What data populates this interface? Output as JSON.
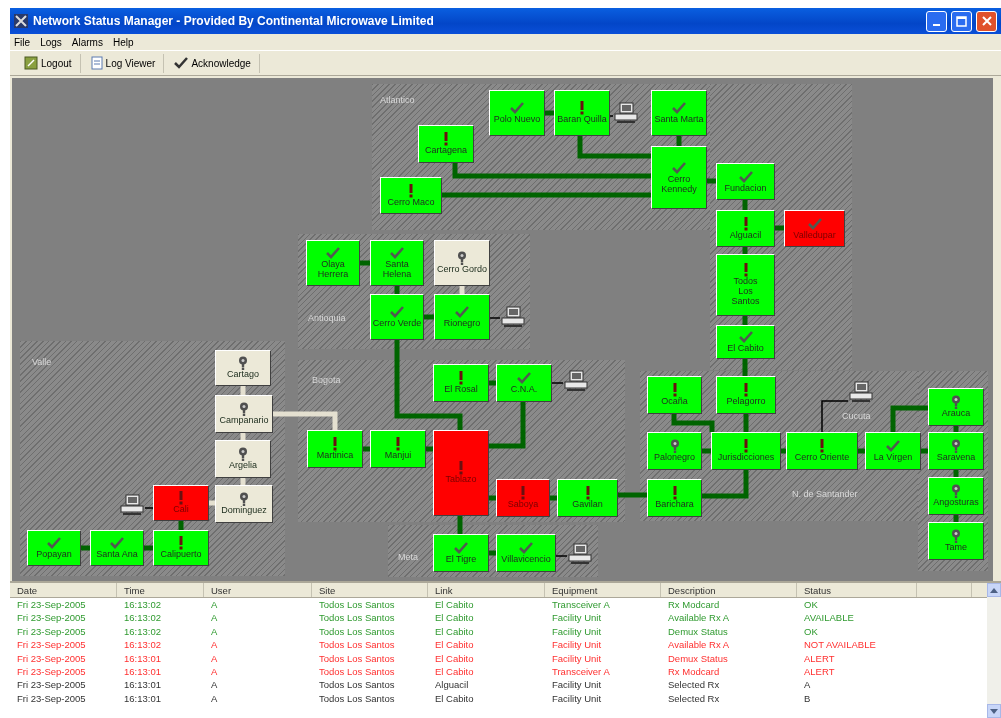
{
  "window": {
    "title": "Network Status Manager - Provided By Continental Microwave Limited"
  },
  "menu": [
    "File",
    "Logs",
    "Alarms",
    "Help"
  ],
  "toolbar": [
    {
      "label": "Logout",
      "kind": "logout"
    },
    {
      "label": "Log Viewer",
      "kind": "viewer"
    },
    {
      "label": "Acknowledge",
      "kind": "ack"
    }
  ],
  "regions": [
    {
      "name": "Atlantico"
    },
    {
      "name": "Antioquia"
    },
    {
      "name": "Valle"
    },
    {
      "name": "Bogota"
    },
    {
      "name": "Meta"
    },
    {
      "name": "N. de Santander"
    }
  ],
  "terminal_labels": [
    "Cucuta"
  ],
  "nodes": [
    {
      "label": "Polo Nuevo",
      "kind": "ok",
      "color": "#00ff00"
    },
    {
      "label": "Baran Quilla",
      "kind": "alert",
      "color": "#00ff00"
    },
    {
      "label": "Santa Marta",
      "kind": "ok",
      "color": "#00ff00"
    },
    {
      "label": "Cartagena",
      "kind": "alert",
      "color": "#00ff00"
    },
    {
      "label": "Cerro Kennedy",
      "kind": "ok",
      "color": "#00ff00"
    },
    {
      "label": "Cerro Maco",
      "kind": "alert",
      "color": "#00ff00"
    },
    {
      "label": "Fundacion",
      "kind": "ok",
      "color": "#00ff00"
    },
    {
      "label": "Alguacil",
      "kind": "alert",
      "color": "#00ff00"
    },
    {
      "label": "Valledupar",
      "kind": "ok",
      "color": "#ff0000"
    },
    {
      "label": "Todos Los Santos",
      "kind": "alert",
      "color": "#00ff00"
    },
    {
      "label": "El Cabito",
      "kind": "ok",
      "color": "#00ff00"
    },
    {
      "label": "Olaya Herrera",
      "kind": "ok",
      "color": "#00ff00"
    },
    {
      "label": "Santa Helena",
      "kind": "ok",
      "color": "#00ff00"
    },
    {
      "label": "Cerro Gordo",
      "kind": "unknown",
      "color": "#ece9d8"
    },
    {
      "label": "Cerro Verde",
      "kind": "ok",
      "color": "#00ff00"
    },
    {
      "label": "Rionegro",
      "kind": "ok",
      "color": "#00ff00"
    },
    {
      "label": "Cartago",
      "kind": "unknown",
      "color": "#ece9d8"
    },
    {
      "label": "Campanario",
      "kind": "unknown",
      "color": "#ece9d8"
    },
    {
      "label": "Argelia",
      "kind": "unknown",
      "color": "#ece9d8"
    },
    {
      "label": "Dominguez",
      "kind": "unknown",
      "color": "#ece9d8"
    },
    {
      "label": "Cali",
      "kind": "alert",
      "color": "#ff0000"
    },
    {
      "label": "Popayan",
      "kind": "ok",
      "color": "#00ff00"
    },
    {
      "label": "Santa Ana",
      "kind": "ok",
      "color": "#00ff00"
    },
    {
      "label": "Calipuerto",
      "kind": "alert",
      "color": "#00ff00"
    },
    {
      "label": "El Rosal",
      "kind": "alert",
      "color": "#00ff00"
    },
    {
      "label": "C.N.A.",
      "kind": "ok",
      "color": "#00ff00"
    },
    {
      "label": "Martinica",
      "kind": "alert",
      "color": "#00ff00"
    },
    {
      "label": "Manjui",
      "kind": "alert",
      "color": "#00ff00"
    },
    {
      "label": "Tablazo",
      "kind": "alert",
      "color": "#ff0000"
    },
    {
      "label": "Saboya",
      "kind": "alert",
      "color": "#ff0000"
    },
    {
      "label": "Gavilan",
      "kind": "alert",
      "color": "#00ff00"
    },
    {
      "label": "El Tigre",
      "kind": "ok",
      "color": "#00ff00"
    },
    {
      "label": "Villavicencio",
      "kind": "ok",
      "color": "#00ff00"
    },
    {
      "label": "Ocaña",
      "kind": "alert",
      "color": "#00ff00"
    },
    {
      "label": "Pelagorro",
      "kind": "alert",
      "color": "#00ff00"
    },
    {
      "label": "Palonegro",
      "kind": "unknown",
      "color": "#00ff00"
    },
    {
      "label": "Jurisdicciones",
      "kind": "alert",
      "color": "#00ff00"
    },
    {
      "label": "Cerro Oriente",
      "kind": "alert",
      "color": "#00ff00"
    },
    {
      "label": "La Virgen",
      "kind": "ok",
      "color": "#00ff00"
    },
    {
      "label": "Arauca",
      "kind": "unknown",
      "color": "#00ff00"
    },
    {
      "label": "Saravena",
      "kind": "unknown",
      "color": "#00ff00"
    },
    {
      "label": "Angosturas",
      "kind": "unknown",
      "color": "#00ff00"
    },
    {
      "label": "Tame",
      "kind": "unknown",
      "color": "#00ff00"
    },
    {
      "label": "Barichara",
      "kind": "alert",
      "color": "#00ff00"
    }
  ],
  "log_table": {
    "columns": [
      "Date",
      "Time",
      "User",
      "Site",
      "Link",
      "Equipment",
      "Description",
      "Status"
    ],
    "rows": [
      {
        "kind": "ok",
        "cells": [
          "Fri 23-Sep-2005",
          "16:13:02",
          "A",
          "Todos Los Santos",
          "El Cabito",
          "Transceiver A",
          "Rx Modcard",
          "OK"
        ]
      },
      {
        "kind": "ok",
        "cells": [
          "Fri 23-Sep-2005",
          "16:13:02",
          "A",
          "Todos Los Santos",
          "El Cabito",
          "Facility Unit",
          "Available Rx A",
          "AVAILABLE"
        ]
      },
      {
        "kind": "ok",
        "cells": [
          "Fri 23-Sep-2005",
          "16:13:02",
          "A",
          "Todos Los Santos",
          "El Cabito",
          "Facility Unit",
          "Demux Status",
          "OK"
        ]
      },
      {
        "kind": "alert",
        "cells": [
          "Fri 23-Sep-2005",
          "16:13:02",
          "A",
          "Todos Los Santos",
          "El Cabito",
          "Facility Unit",
          "Available Rx A",
          "NOT AVAILABLE"
        ]
      },
      {
        "kind": "alert",
        "cells": [
          "Fri 23-Sep-2005",
          "16:13:01",
          "A",
          "Todos Los Santos",
          "El Cabito",
          "Facility Unit",
          "Demux Status",
          "ALERT"
        ]
      },
      {
        "kind": "alert",
        "cells": [
          "Fri 23-Sep-2005",
          "16:13:01",
          "A",
          "Todos Los Santos",
          "El Cabito",
          "Transceiver A",
          "Rx Modcard",
          "ALERT"
        ]
      },
      {
        "kind": "info",
        "cells": [
          "Fri 23-Sep-2005",
          "16:13:01",
          "A",
          "Todos Los Santos",
          "Alguacil",
          "Facility Unit",
          "Selected Rx",
          "A"
        ]
      },
      {
        "kind": "info",
        "cells": [
          "Fri 23-Sep-2005",
          "16:13:01",
          "A",
          "Todos Los Santos",
          "El Cabito",
          "Facility Unit",
          "Selected Rx",
          "B"
        ]
      }
    ]
  }
}
